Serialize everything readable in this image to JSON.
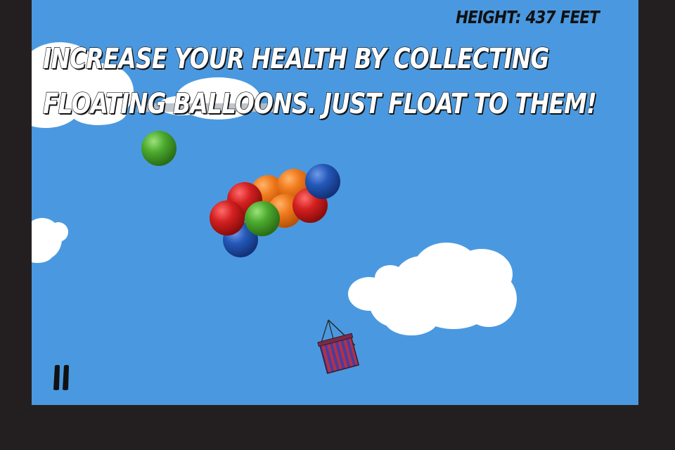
{
  "hud": {
    "height_label": "HEIGHT:",
    "height_value": "437",
    "height_unit": "FEET"
  },
  "tutorial": {
    "hint_line1": "INCREASE YOUR HEALTH BY COLLECTING",
    "hint_line2": "FLOATING BALLOONS. JUST FLOAT TO THEM!"
  },
  "controls": {
    "pause_icon": "pause-icon"
  },
  "colors": {
    "sky": "#4a99e0",
    "frame": "#231f20",
    "cloud": "#ffffff",
    "balloon_red": "#cc1f1f",
    "balloon_blue": "#1e55b0",
    "balloon_green": "#4aa82c",
    "balloon_orange": "#ee7a1a",
    "basket_stripe_red": "#b03040",
    "basket_stripe_blue": "#4a3aa0"
  }
}
